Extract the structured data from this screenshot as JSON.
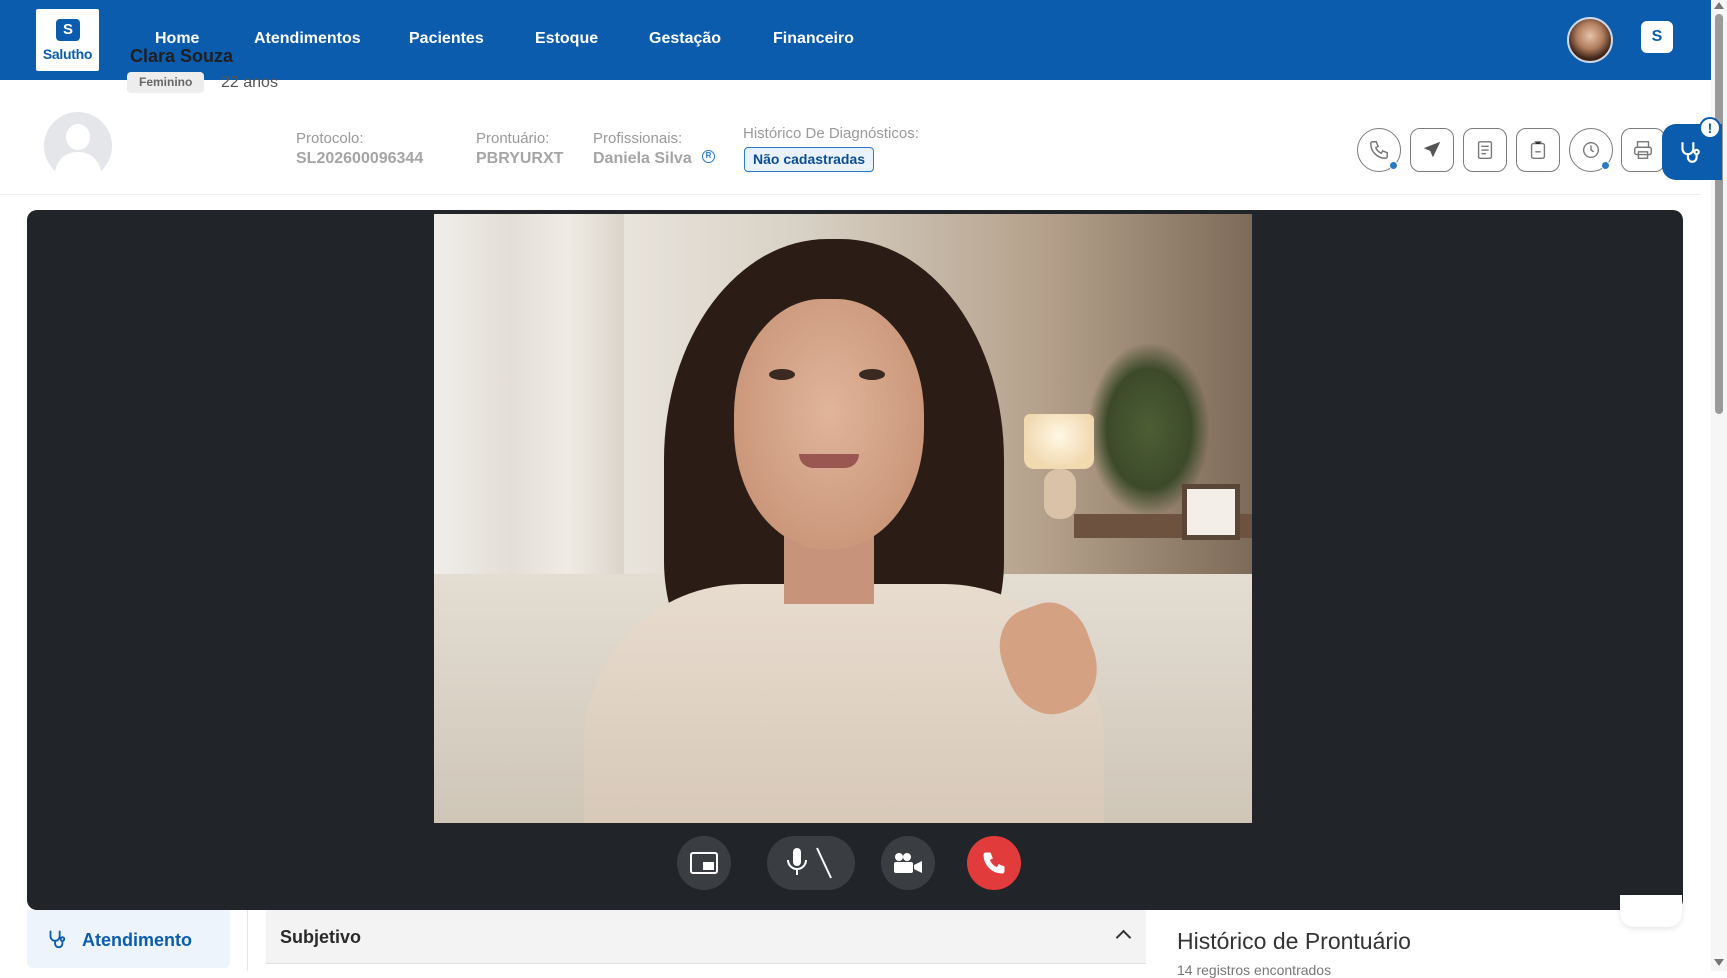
{
  "app": {
    "logo_text": "Salutho",
    "logo_mark": "S"
  },
  "nav": {
    "items": [
      {
        "label": "Home"
      },
      {
        "label": "Atendimentos"
      },
      {
        "label": "Pacientes"
      },
      {
        "label": "Estoque"
      },
      {
        "label": "Gestação"
      },
      {
        "label": "Financeiro"
      }
    ]
  },
  "patient": {
    "name": "Clara Souza",
    "sex": "Feminino",
    "age": "22 anos",
    "protocol_label": "Protocolo:",
    "protocol_value": "SL202600096344",
    "record_label": "Prontuário:",
    "record_value": "PBRYURXT",
    "professionals_label": "Profissionais:",
    "professionals_value": "Daniela Silva",
    "diagnosis_label": "Histórico De Diagnósticos:",
    "diagnosis_value": "Não cadastradas"
  },
  "actions": [
    {
      "icon": "phone-icon"
    },
    {
      "icon": "send-icon"
    },
    {
      "icon": "document-icon"
    },
    {
      "icon": "clipboard-icon"
    },
    {
      "icon": "history-icon"
    },
    {
      "icon": "printer-icon"
    }
  ],
  "alert_symbol": "!",
  "call_controls": [
    {
      "icon": "picture-in-picture-icon"
    },
    {
      "icon": "microphone-muted-icon"
    },
    {
      "icon": "video-camera-icon"
    },
    {
      "icon": "hang-up-icon"
    }
  ],
  "colors": {
    "brand": "#0b5cad",
    "hangup": "#e23b3b",
    "video_bg": "#212529"
  },
  "bottom": {
    "tab_label": "Atendimento",
    "accordion_label": "Subjetivo",
    "history_title": "Histórico de Prontuário",
    "history_subtitle": "14 registros encontrados"
  }
}
